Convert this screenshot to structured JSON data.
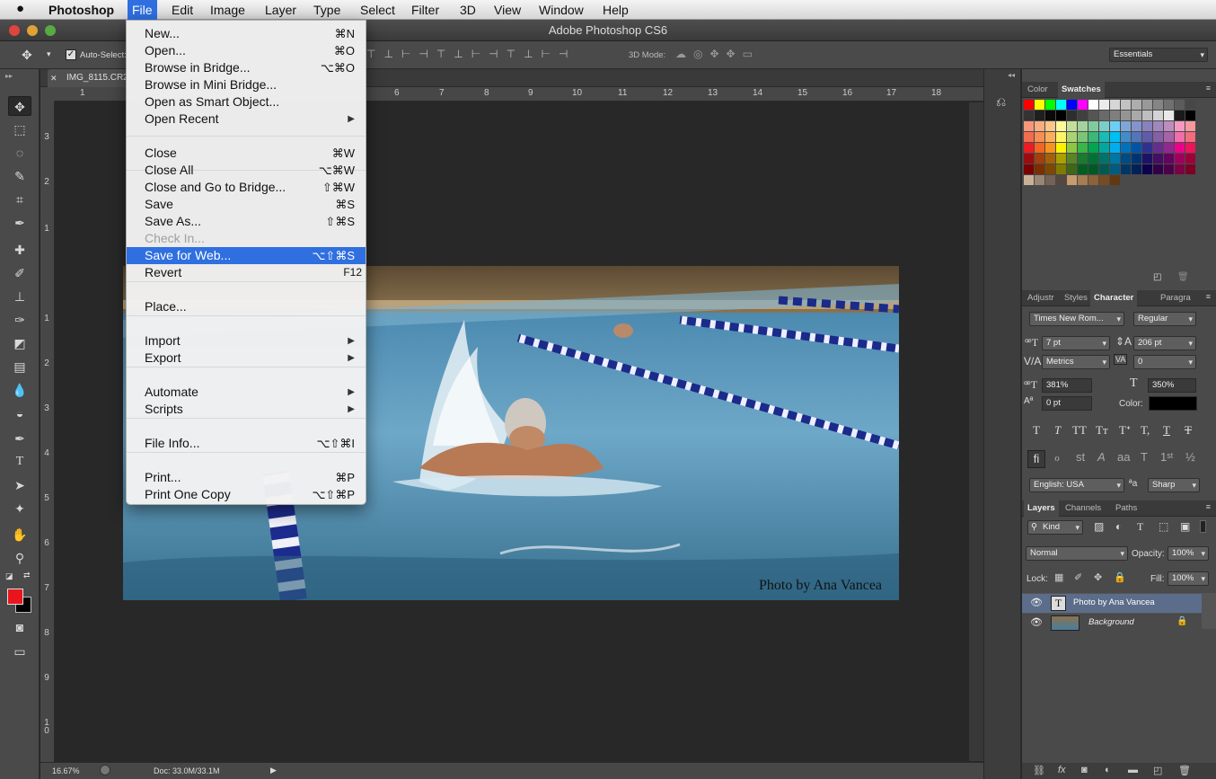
{
  "menubar": {
    "apple": "",
    "items": [
      "Photoshop",
      "File",
      "Edit",
      "Image",
      "Layer",
      "Type",
      "Select",
      "Filter",
      "3D",
      "View",
      "Window",
      "Help"
    ]
  },
  "window": {
    "title": "Adobe Photoshop CS6"
  },
  "options_bar": {
    "auto_select": "Auto-Select:",
    "three_d_mode": "3D Mode:",
    "workspace": "Essentials"
  },
  "document": {
    "tab": "IMG_8115.CR2",
    "ruler_h": [
      "1",
      "6",
      "7",
      "8",
      "9",
      "10",
      "11",
      "12",
      "13",
      "14",
      "15",
      "16",
      "17",
      "18"
    ],
    "ruler_v": [
      "3",
      "2",
      "1",
      "1",
      "2",
      "3",
      "4",
      "5",
      "6",
      "7",
      "8",
      "9",
      "1 0"
    ],
    "zoom": "16.67%",
    "doc_size": "Doc: 33.0M/33.1M",
    "watermark": "Photo by Ana Vancea"
  },
  "file_menu": {
    "items": [
      {
        "label": "New...",
        "shortcut": "⌘N"
      },
      {
        "label": "Open...",
        "shortcut": "⌘O"
      },
      {
        "label": "Browse in Bridge...",
        "shortcut": "⌥⌘O"
      },
      {
        "label": "Browse in Mini Bridge...",
        "shortcut": ""
      },
      {
        "label": "Open as Smart Object...",
        "shortcut": ""
      },
      {
        "label": "Open Recent",
        "shortcut": "▶"
      },
      {
        "label": "Close",
        "shortcut": "⌘W"
      },
      {
        "label": "Close All",
        "shortcut": "⌥⌘W"
      },
      {
        "label": "Close and Go to Bridge...",
        "shortcut": "⇧⌘W"
      },
      {
        "label": "Save",
        "shortcut": "⌘S"
      },
      {
        "label": "Save As...",
        "shortcut": "⇧⌘S"
      },
      {
        "label": "Check In...",
        "shortcut": ""
      },
      {
        "label": "Save for Web...",
        "shortcut": "⌥⇧⌘S"
      },
      {
        "label": "Revert",
        "shortcut": "F12"
      },
      {
        "label": "Place...",
        "shortcut": ""
      },
      {
        "label": "Import",
        "shortcut": "▶"
      },
      {
        "label": "Export",
        "shortcut": "▶"
      },
      {
        "label": "Automate",
        "shortcut": "▶"
      },
      {
        "label": "Scripts",
        "shortcut": "▶"
      },
      {
        "label": "File Info...",
        "shortcut": "⌥⇧⌘I"
      },
      {
        "label": "Print...",
        "shortcut": "⌘P"
      },
      {
        "label": "Print One Copy",
        "shortcut": "⌥⇧⌘P"
      }
    ]
  },
  "swatches_panel": {
    "tabs": [
      "Color",
      "Swatches"
    ]
  },
  "character_panel": {
    "tabs": [
      "Adjustr",
      "Styles",
      "Character",
      "Paragra"
    ],
    "font_family": "Times New Rom...",
    "font_style": "Regular",
    "size": "7 pt",
    "leading": "206 pt",
    "kerning": "Metrics",
    "tracking": "0",
    "vscale": "381%",
    "hscale": "350%",
    "baseline": "0 pt",
    "color_label": "Color:",
    "language": "English: USA",
    "aa_label": "ªa",
    "antialias": "Sharp"
  },
  "layers_panel": {
    "tabs": [
      "Layers",
      "Channels",
      "Paths"
    ],
    "filter": "Kind",
    "blend_mode": "Normal",
    "opacity_label": "Opacity:",
    "opacity": "100%",
    "lock_label": "Lock:",
    "fill_label": "Fill:",
    "fill": "100%",
    "layers": [
      {
        "name": "Photo by Ana Vancea",
        "thumb": "T"
      },
      {
        "name": "Background",
        "thumb": ""
      }
    ]
  }
}
